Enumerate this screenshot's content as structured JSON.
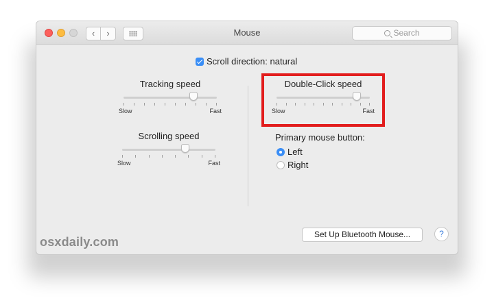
{
  "window": {
    "title": "Mouse",
    "search_placeholder": "Search",
    "nav_back": "‹",
    "nav_forward": "›"
  },
  "scroll_direction": {
    "label": "Scroll direction: natural",
    "checked": true
  },
  "tracking_speed": {
    "title": "Tracking speed",
    "min_label": "Slow",
    "max_label": "Fast",
    "value_fraction": 0.75,
    "tick_count": 10
  },
  "scrolling_speed": {
    "title": "Scrolling speed",
    "min_label": "Slow",
    "max_label": "Fast",
    "value_fraction": 0.68,
    "tick_count": 8
  },
  "double_click_speed": {
    "title": "Double-Click speed",
    "min_label": "Slow",
    "max_label": "Fast",
    "value_fraction": 0.86,
    "tick_count": 11
  },
  "primary_button": {
    "label": "Primary mouse button:",
    "options": [
      "Left",
      "Right"
    ],
    "selected": "Left"
  },
  "bluetooth_button": "Set Up Bluetooth Mouse...",
  "help_button": "?",
  "watermark": "osxdaily.com",
  "colors": {
    "accent": "#3a8ef6",
    "highlight_box": "#e21d1d",
    "close": "#fc605c",
    "minimize": "#fdbc40"
  }
}
